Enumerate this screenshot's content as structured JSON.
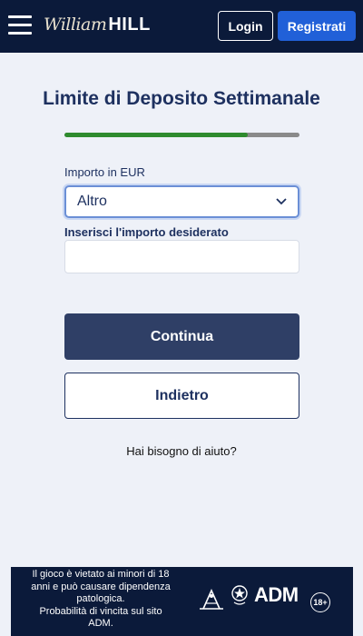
{
  "header": {
    "logo_script": "William",
    "logo_bold": "HILL",
    "login_label": "Login",
    "register_label": "Registrati"
  },
  "main": {
    "title": "Limite di Deposito Settimanale",
    "progress_fraction": 0.78,
    "amount_label": "Importo in EUR",
    "select_value": "Altro",
    "custom_amount_label": "Inserisci l'importo desiderato",
    "custom_amount_value": "",
    "continue_label": "Continua",
    "back_label": "Indietro",
    "help_text": "Hai bisogno di aiuto?"
  },
  "footer": {
    "warning_line1": "Il gioco è vietato ai minori di 18",
    "warning_line2": "anni e può causare dipendenza",
    "warning_line3": "patologica.",
    "warning_line4": "Probabilità di vincita sul sito",
    "warning_line5": "ADM.",
    "adm_label": "ADM",
    "age_label": "18+"
  },
  "colors": {
    "header_bg": "#0b1a3a",
    "accent_blue": "#2160d8",
    "primary_button": "#2f3f66",
    "progress_green": "#2e8b2e",
    "title_color": "#1e3160"
  },
  "icons": {
    "menu": "hamburger-icon",
    "select": "chevron-down-icon",
    "seal": "adm-seal-icon",
    "emblem": "italian-republic-emblem-icon"
  }
}
